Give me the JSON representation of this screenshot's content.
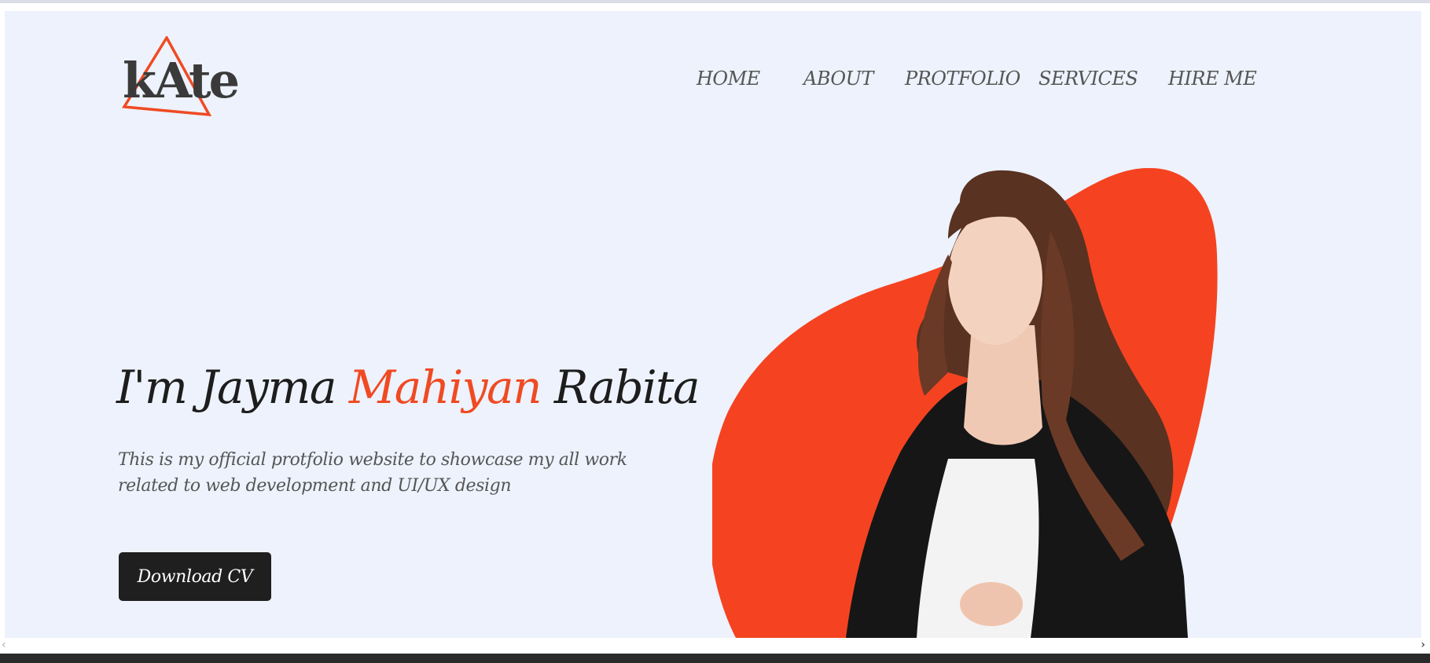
{
  "logo": {
    "text": "kAte",
    "accent_color": "#f04a23"
  },
  "nav": {
    "items": [
      "HOME",
      "ABOUT",
      "PROTFOLIO",
      "SERVICES",
      "HIRE ME"
    ]
  },
  "hero": {
    "headline_part1": "I'm Jayma ",
    "headline_accent": "Mahiyan",
    "headline_part2": " Rabita",
    "subtitle": "This is my official protfolio website to showcase my all work related to web development and UI/UX design",
    "button_label": "Download CV",
    "accent_color": "#f04a23",
    "background_color": "#edf2fc"
  },
  "scrollbar": {
    "left_arrow": "‹",
    "right_arrow": "›"
  }
}
